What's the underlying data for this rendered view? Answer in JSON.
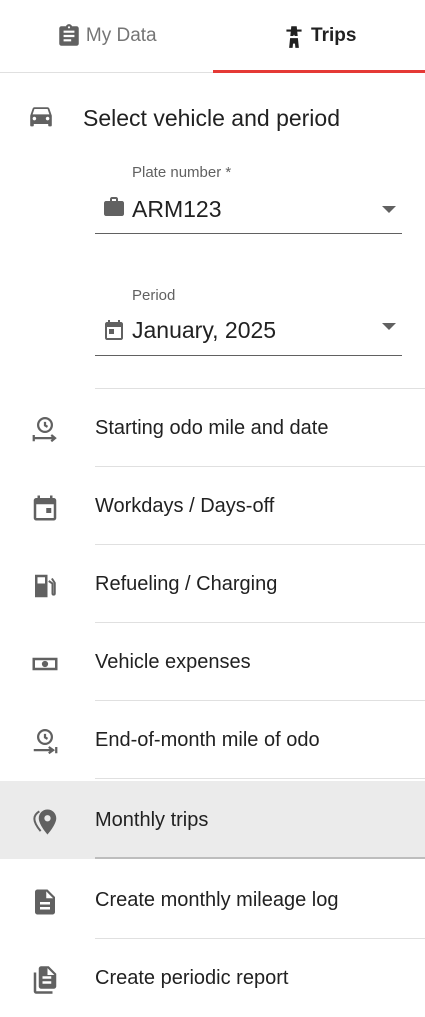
{
  "tabs": [
    {
      "label": "My Data",
      "icon": "clipboard-icon",
      "active": false
    },
    {
      "label": "Trips",
      "icon": "road-icon",
      "active": true
    }
  ],
  "section": {
    "title": "Select vehicle and period",
    "icon": "car-icon"
  },
  "plate": {
    "label": "Plate number *",
    "value": "ARM123",
    "icon": "briefcase-icon"
  },
  "period": {
    "label": "Period",
    "value": "January, 2025",
    "icon": "calendar-icon"
  },
  "menu": [
    {
      "label": "Starting odo mile and date",
      "icon": "clock-arrow-start-icon"
    },
    {
      "label": "Workdays / Days-off",
      "icon": "calendar-day-icon"
    },
    {
      "label": "Refueling / Charging",
      "icon": "fuel-pump-icon"
    },
    {
      "label": "Vehicle expenses",
      "icon": "money-icon"
    },
    {
      "label": "End-of-month mile of odo",
      "icon": "clock-arrow-end-icon"
    },
    {
      "label": "Monthly trips",
      "icon": "location-pin-icon",
      "selected": true
    },
    {
      "label": "Create monthly mileage log",
      "icon": "document-icon"
    },
    {
      "label": "Create periodic report",
      "icon": "documents-icon"
    }
  ],
  "colors": {
    "accent": "#e53935",
    "selected_bg": "#ebebeb"
  }
}
